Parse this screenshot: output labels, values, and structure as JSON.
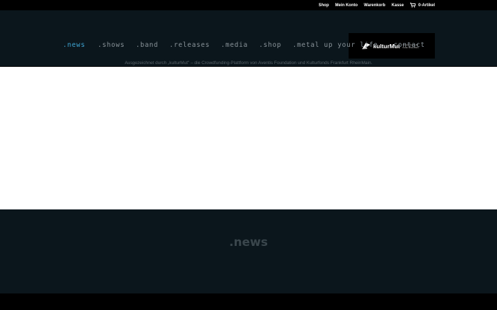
{
  "topbar": {
    "links": [
      "Shop",
      "Mein Konto",
      "Warenkorb",
      "Kasse"
    ],
    "cart_label": "0-Artikel",
    "cart_icon": "cart-icon"
  },
  "nav": {
    "items": [
      ".news",
      ".shows",
      ".band",
      ".releases",
      ".media",
      ".shop",
      ".metal up your life",
      ".contact"
    ],
    "active": ".news",
    "active_color": "#3fa7d6",
    "color": "#8a949a"
  },
  "logo": {
    "text": "kulturMut",
    "sub": "Crowdfunding für Kultur RheinMain"
  },
  "award_text": "Ausgezeichnet durch „kulturMut\" – die Crowdfunding-Plattform von Aventis Foundation und Kulturfonds Frankfurt RheinMain.",
  "section": {
    "title": ".news"
  },
  "colors": {
    "header_bg": "#0b161c",
    "topbar_bg": "#000000",
    "content_bg": "#ffffff"
  }
}
